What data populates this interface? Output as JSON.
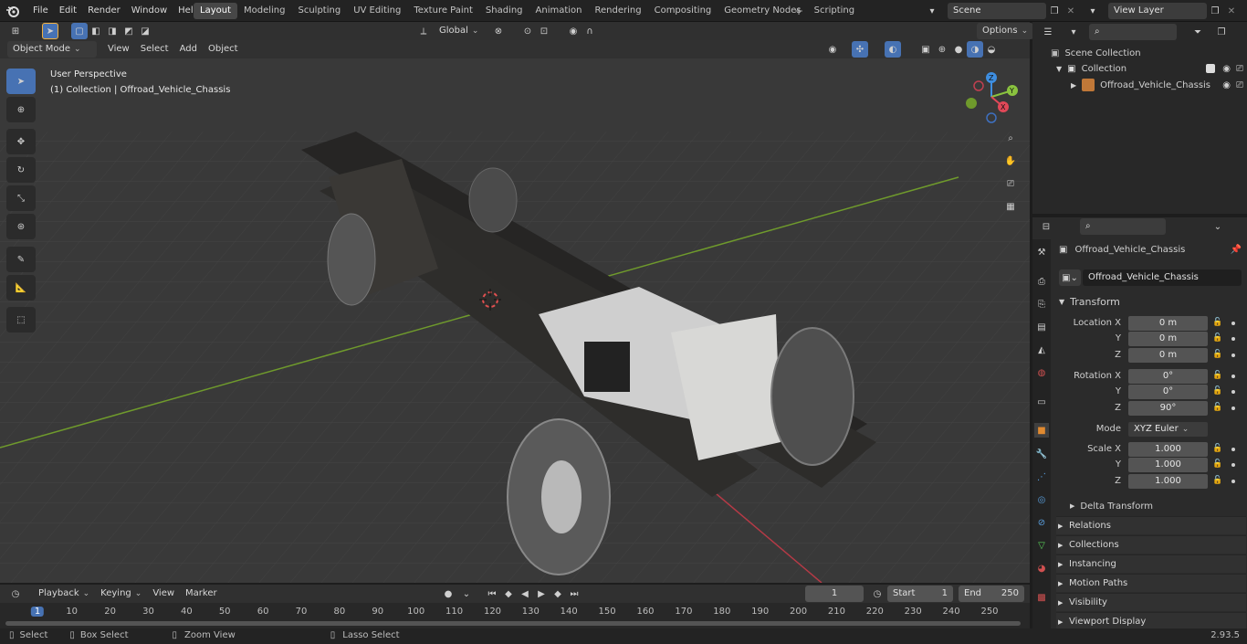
{
  "menu": [
    "File",
    "Edit",
    "Render",
    "Window",
    "Help"
  ],
  "workspaces": [
    "Layout",
    "Modeling",
    "Sculpting",
    "UV Editing",
    "Texture Paint",
    "Shading",
    "Animation",
    "Rendering",
    "Compositing",
    "Geometry Nodes",
    "Scripting"
  ],
  "active_workspace": "Layout",
  "scene": "Scene",
  "view_layer": "View Layer",
  "header": {
    "transform_orientation": "Global",
    "options": "Options"
  },
  "viewport_header": {
    "mode": "Object Mode",
    "menus": [
      "View",
      "Select",
      "Add",
      "Object"
    ]
  },
  "viewport_overlay": {
    "perspective": "User Perspective",
    "collection_info": "(1) Collection | Offroad_Vehicle_Chassis"
  },
  "gizmo": {
    "z": "Z",
    "y": "Y",
    "x": "X"
  },
  "outliner": {
    "scene_collection": "Scene Collection",
    "collection": "Collection",
    "object": "Offroad_Vehicle_Chassis"
  },
  "properties": {
    "object_name": "Offroad_Vehicle_Chassis",
    "data_name": "Offroad_Vehicle_Chassis",
    "transform_title": "Transform",
    "location_label": "Location X",
    "y": "Y",
    "z": "Z",
    "location": [
      "0 m",
      "0 m",
      "0 m"
    ],
    "rotation_label": "Rotation X",
    "rotation": [
      "0°",
      "0°",
      "90°"
    ],
    "mode_label": "Mode",
    "mode_value": "XYZ Euler",
    "scale_label": "Scale X",
    "scale": [
      "1.000",
      "1.000",
      "1.000"
    ],
    "delta_transform": "Delta Transform",
    "panels": [
      "Relations",
      "Collections",
      "Instancing",
      "Motion Paths",
      "Visibility",
      "Viewport Display"
    ]
  },
  "timeline": {
    "menus": [
      "Playback",
      "Keying",
      "View",
      "Marker"
    ],
    "current_frame": "1",
    "start_label": "Start",
    "start": "1",
    "end_label": "End",
    "end": "250",
    "ticks": [
      "1",
      "10",
      "20",
      "30",
      "40",
      "50",
      "60",
      "70",
      "80",
      "90",
      "100",
      "110",
      "120",
      "130",
      "140",
      "150",
      "160",
      "170",
      "180",
      "190",
      "200",
      "210",
      "220",
      "230",
      "240",
      "250"
    ]
  },
  "status": {
    "select": "Select",
    "box_select": "Box Select",
    "zoom_view": "Zoom View",
    "lasso_select": "Lasso Select",
    "version": "2.93.5"
  },
  "colors": {
    "accent": "#4772b3",
    "x_axis": "#e04858",
    "y_axis": "#8ac33f",
    "z_axis": "#3e8ee0"
  }
}
